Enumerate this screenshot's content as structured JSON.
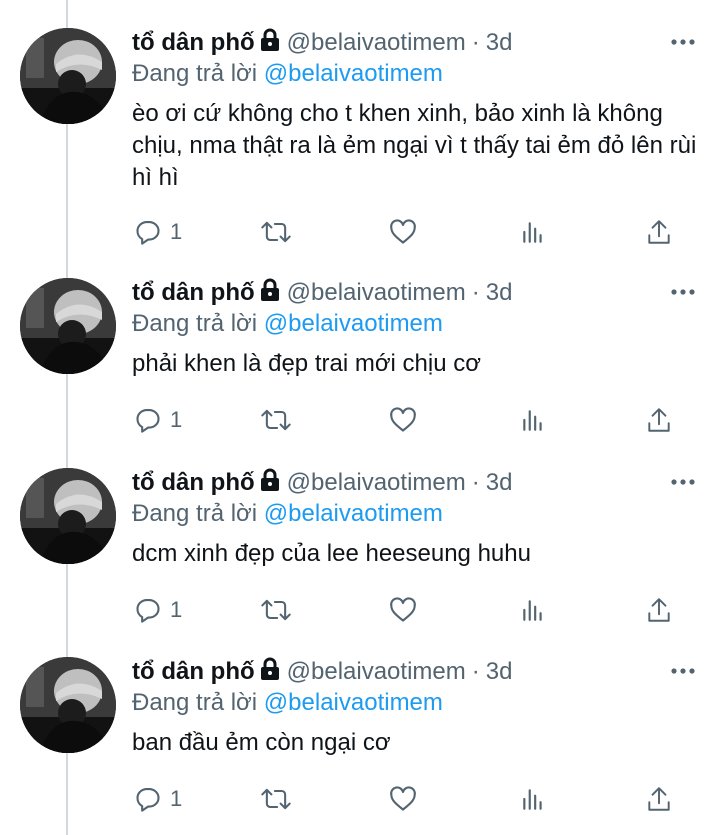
{
  "colors": {
    "link": "#1d9bf0",
    "muted": "#536471",
    "text": "#0f1419",
    "thread_line": "#cfd9de"
  },
  "tweets": [
    {
      "name": "tổ dân phố",
      "handle": "@belaivaotimem",
      "separator": "·",
      "time": "3d",
      "reply_prefix": "Đang trả lời",
      "reply_handle": "@belaivaotimem",
      "text": "èo ơi cứ không cho t khen xinh, bảo xinh là không chịu, nma thật ra là ẻm ngại vì t thấy tai ẻm đỏ lên rùi hì hì",
      "reply_count": "1"
    },
    {
      "name": "tổ dân phố",
      "handle": "@belaivaotimem",
      "separator": "·",
      "time": "3d",
      "reply_prefix": "Đang trả lời",
      "reply_handle": "@belaivaotimem",
      "text": "phải khen là đẹp trai mới chịu cơ",
      "reply_count": "1"
    },
    {
      "name": "tổ dân phố",
      "handle": "@belaivaotimem",
      "separator": "·",
      "time": "3d",
      "reply_prefix": "Đang trả lời",
      "reply_handle": "@belaivaotimem",
      "text": "dcm xinh đẹp của lee heeseung huhu",
      "reply_count": "1"
    },
    {
      "name": "tổ dân phố",
      "handle": "@belaivaotimem",
      "separator": "·",
      "time": "3d",
      "reply_prefix": "Đang trả lời",
      "reply_handle": "@belaivaotimem",
      "text": "ban đầu ẻm còn ngại cơ",
      "reply_count": "1"
    }
  ],
  "icons": {
    "lock": "lock-icon",
    "more": "more-icon",
    "reply": "reply-icon",
    "retweet": "retweet-icon",
    "like": "heart-icon",
    "views": "analytics-icon",
    "share": "share-icon"
  }
}
